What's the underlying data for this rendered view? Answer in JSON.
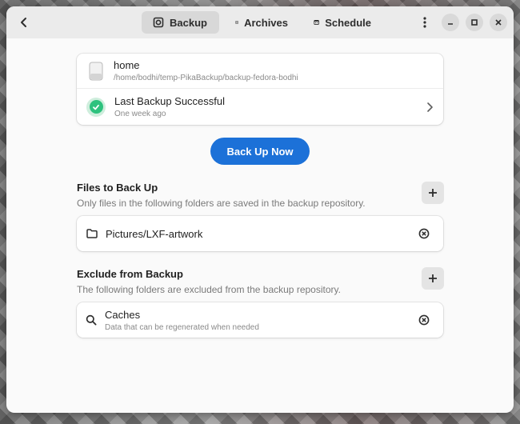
{
  "header": {
    "tabs": [
      {
        "label": "Backup",
        "icon": "backup-icon"
      },
      {
        "label": "Archives",
        "icon": "archive-icon"
      },
      {
        "label": "Schedule",
        "icon": "calendar-icon"
      }
    ],
    "active_tab": "Backup"
  },
  "location": {
    "name": "home",
    "path": "/home/bodhi/temp-PikaBackup/backup-fedora-bodhi",
    "icon": "drive-icon"
  },
  "status": {
    "title": "Last Backup Successful",
    "subtitle": "One week ago",
    "icon": "check-icon",
    "color": "#2ec27e"
  },
  "primary_button": {
    "label": "Back Up Now",
    "color": "#1c71d8"
  },
  "include": {
    "title": "Files to Back Up",
    "description": "Only files in the following folders are saved in the backup repository.",
    "items": [
      {
        "label": "Pictures/LXF-artwork",
        "icon": "folder-icon"
      }
    ]
  },
  "exclude": {
    "title": "Exclude from Backup",
    "description": "The following folders are excluded from the backup repository.",
    "items": [
      {
        "label": "Caches",
        "sublabel": "Data that can be regenerated when needed",
        "icon": "search-icon"
      }
    ]
  }
}
